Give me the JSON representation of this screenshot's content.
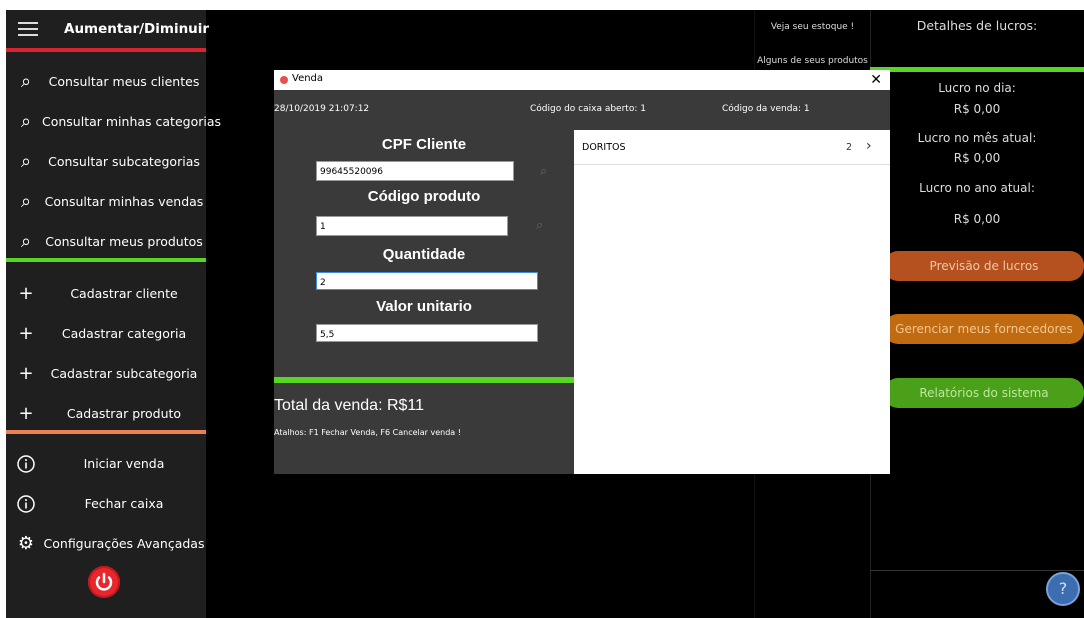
{
  "sidebar": {
    "title": "Aumentar/Diminuir",
    "items": [
      {
        "icon": "search-icon",
        "label": "Consultar meus clientes"
      },
      {
        "icon": "search-icon",
        "label": "Consultar minhas categorias"
      },
      {
        "icon": "search-icon",
        "label": "Consultar subcategorias"
      },
      {
        "icon": "search-icon",
        "label": "Consultar minhas vendas"
      },
      {
        "icon": "search-icon",
        "label": "Consultar meus produtos"
      },
      {
        "icon": "plus-icon",
        "label": "Cadastrar cliente"
      },
      {
        "icon": "plus-icon",
        "label": "Cadastrar categoria"
      },
      {
        "icon": "plus-icon",
        "label": "Cadastrar subcategoria"
      },
      {
        "icon": "plus-icon",
        "label": "Cadastrar produto"
      },
      {
        "icon": "info-icon",
        "label": "Iniciar venda"
      },
      {
        "icon": "info-icon",
        "label": "Fechar caixa"
      },
      {
        "icon": "gear-icon",
        "label": "Configurações Avançadas"
      }
    ],
    "colors": {
      "red": "#d9232e",
      "green": "#57d622",
      "orange": "#e8804f",
      "power": "#e8262c"
    }
  },
  "stock": {
    "line1": "Veja seu estoque !",
    "line2": "Alguns de seus produtos"
  },
  "profits": {
    "title": "Detalhes de lucros:",
    "day_label": "Lucro no dia:",
    "day_value": "R$ 0,00",
    "month_label": "Lucro no mês atual:",
    "month_value": "R$ 0,00",
    "year_label": "Lucro no ano atual:",
    "year_value": "R$ 0,00",
    "buttons": [
      {
        "label": "Previsão de lucros",
        "bg": "#b5511e",
        "fg": "#f0c8a8"
      },
      {
        "label": "Gerenciar meus fornecedores",
        "bg": "#c06a12",
        "fg": "#f3c78d"
      },
      {
        "label": "Relatórios do sistema",
        "bg": "#4aa018",
        "fg": "#bde79f"
      }
    ]
  },
  "dialog": {
    "title": "Venda",
    "datetime": "28/10/2019 21:07:12",
    "cashier": "Código do caixa aberto: 1",
    "sale_code": "Código da venda: 1",
    "cpf_label": "CPF Cliente",
    "cpf_value": "99645520096",
    "product_label": "Código produto",
    "product_value": "1",
    "qty_label": "Quantidade",
    "qty_value": "2",
    "price_label": "Valor unitario",
    "price_value": "5,5",
    "total": "Total da venda: R$11",
    "shortcuts": "Atalhos: F1 Fechar Venda, F6 Cancelar venda !",
    "items": [
      {
        "name": "DORITOS",
        "qty": "2"
      }
    ]
  }
}
